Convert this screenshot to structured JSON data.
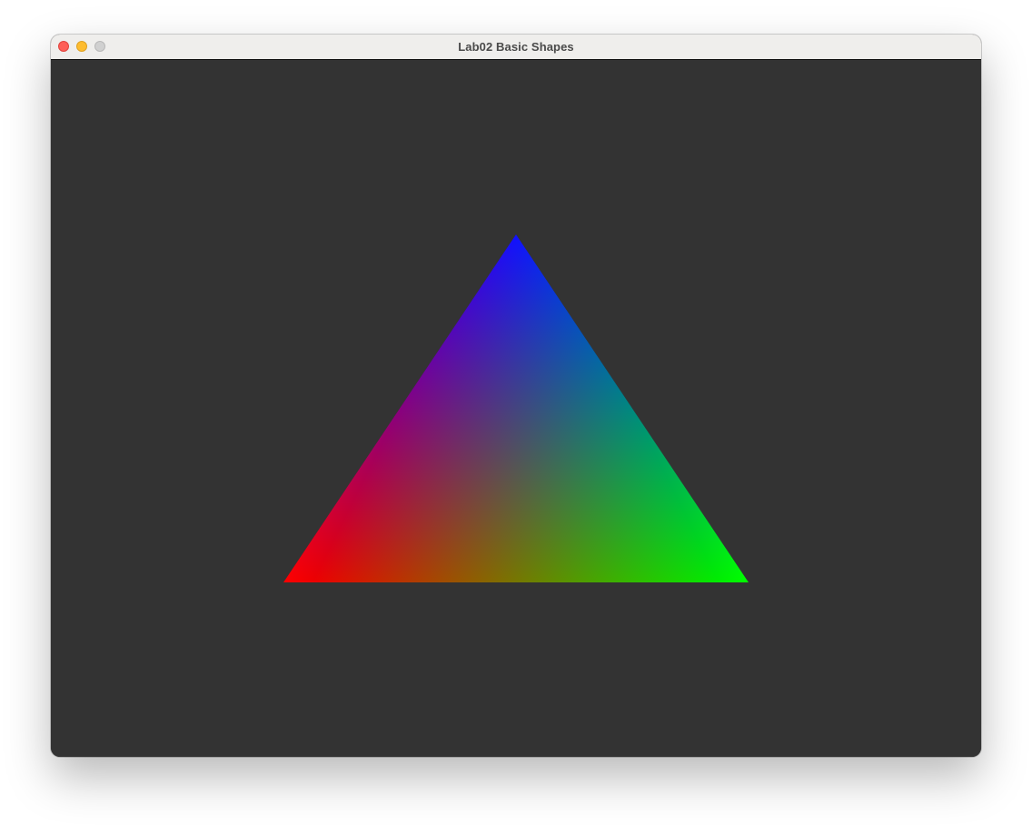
{
  "window": {
    "title": "Lab02 Basic Shapes",
    "controls": {
      "close_icon": "close-icon",
      "minimize_icon": "minimize-icon",
      "zoom_icon": "zoom-icon"
    }
  },
  "canvas": {
    "background_color": "#333333",
    "shape": {
      "kind": "triangle",
      "vertex_colors": {
        "top": "#0000ff",
        "bottom_left": "#ff0000",
        "bottom_right": "#00ff00"
      }
    }
  }
}
